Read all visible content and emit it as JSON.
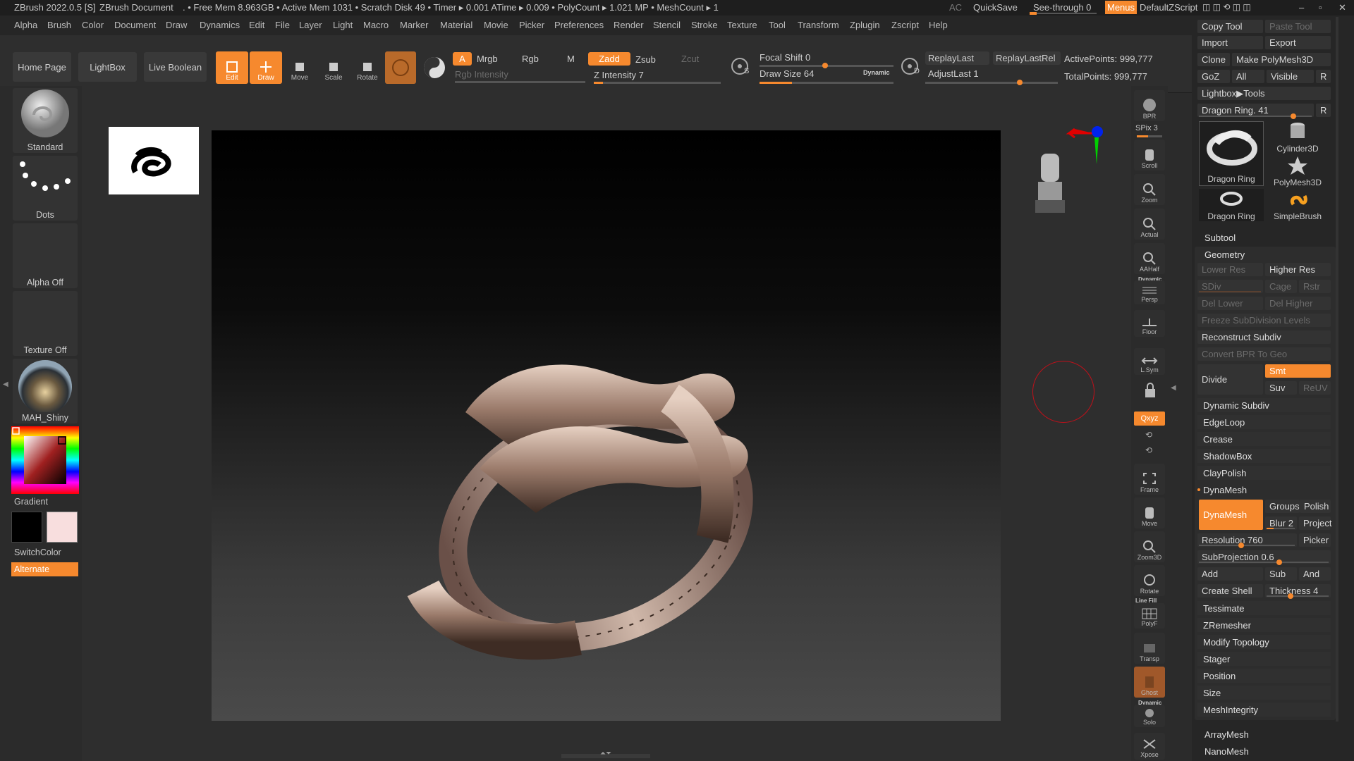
{
  "title_bar": {
    "app": "ZBrush 2022.0.5 [S]",
    "document": "ZBrush Document",
    "stats": ". • Free Mem 8.963GB • Active Mem 1031 • Scratch Disk 49 • Timer ▸ 0.001 ATime ▸ 0.009 • PolyCount ▸ 1.021 MP • MeshCount ▸ 1",
    "ac": "AC",
    "quicksave": "QuickSave",
    "see_through": "See-through 0",
    "menus": "Menus",
    "script": "DefaultZScript"
  },
  "menu_items": [
    "Alpha",
    "Brush",
    "Color",
    "Document",
    "Draw",
    "Dynamics",
    "Edit",
    "File",
    "Layer",
    "Light",
    "Macro",
    "Marker",
    "Material",
    "Movie",
    "Picker",
    "Preferences",
    "Render",
    "Stencil",
    "Stroke",
    "Texture",
    "Tool",
    "Transform",
    "Zplugin",
    "Zscript",
    "Help"
  ],
  "top_shelf": {
    "home": "Home Page",
    "lightbox": "LightBox",
    "live_boolean": "Live Boolean",
    "edit": "Edit",
    "draw": "Draw",
    "move": "Move",
    "scale": "Scale",
    "rotate": "Rotate",
    "a": "A",
    "mrgb": "Mrgb",
    "rgb": "Rgb",
    "m": "M",
    "rgb_intensity": "Rgb Intensity",
    "zadd": "Zadd",
    "zsub": "Zsub",
    "zcut": "Zcut",
    "z_intensity": "Z Intensity 7",
    "z_intensity_value": 7,
    "focal_shift": "Focal Shift 0",
    "draw_size": "Draw Size 64",
    "dynamic": "Dynamic",
    "replay_last": "ReplayLast",
    "replay_last_rel": "ReplayLastRel",
    "adjust_last": "AdjustLast 1",
    "active_points": "ActivePoints: 999,777",
    "total_points": "TotalPoints: 999,777",
    "s": "S",
    "d": "D"
  },
  "left_shelf": {
    "brush": "Standard",
    "stroke": "Dots",
    "alpha": "Alpha Off",
    "texture": "Texture Off",
    "material": "MAH_Shiny",
    "gradient": "Gradient",
    "switch_color": "SwitchColor",
    "alternate": "Alternate"
  },
  "right_shelf": [
    {
      "label": "BPR"
    },
    {
      "label": "SPix 3"
    },
    {
      "label": "Scroll"
    },
    {
      "label": "Zoom"
    },
    {
      "label": "Actual"
    },
    {
      "label": "AAHalf"
    },
    {
      "label": "Persp"
    },
    {
      "label": "Floor"
    },
    {
      "label": "L.Sym"
    },
    {
      "label": "Frame"
    },
    {
      "label": "Move"
    },
    {
      "label": "Zoom3D"
    },
    {
      "label": "Rotate"
    },
    {
      "label": "PolyF"
    },
    {
      "label": "Transp"
    },
    {
      "label": "Ghost"
    },
    {
      "label": "Solo"
    },
    {
      "label": "Xpose"
    }
  ],
  "right_shelf_extra": {
    "dynamic1": "Dynamic",
    "xyz": "Qxyz",
    "linefill": "Line Fill",
    "dynamic2": "Dynamic"
  },
  "tool_panel": {
    "copy_tool": "Copy Tool",
    "paste_tool": "Paste Tool",
    "import": "Import",
    "export": "Export",
    "clone": "Clone",
    "make_polymesh": "Make PolyMesh3D",
    "goz": "GoZ",
    "all": "All",
    "visible": "Visible",
    "r": "R",
    "lightbox_tools": "Lightbox▶Tools",
    "tool_slider": "Dragon Ring. 41",
    "thumbs": [
      "Dragon Ring",
      "Cylinder3D",
      "PolyMesh3D",
      "Dragon Ring",
      "SimpleBrush"
    ],
    "subtool": "Subtool",
    "geometry": "Geometry",
    "lower_res": "Lower Res",
    "higher_res": "Higher Res",
    "sdiv": "SDiv",
    "cage": "Cage",
    "rstr": "Rstr",
    "del_lower": "Del Lower",
    "del_higher": "Del Higher",
    "freeze": "Freeze SubDivision Levels",
    "reconstruct": "Reconstruct Subdiv",
    "convert_bpr": "Convert BPR To Geo",
    "divide": "Divide",
    "smt": "Smt",
    "suv": "Suv",
    "reuv": "ReUV",
    "dynamic_subdiv": "Dynamic Subdiv",
    "edgeloop": "EdgeLoop",
    "crease": "Crease",
    "shadowbox": "ShadowBox",
    "claypolish": "ClayPolish",
    "dynamesh_section": "DynaMesh",
    "dynamesh_btn": "DynaMesh",
    "groups": "Groups",
    "polish": "Polish",
    "blur": "Blur 2",
    "project": "Project",
    "resolution": "Resolution 760",
    "picker": "Picker",
    "subprojection": "SubProjection 0.6",
    "add": "Add",
    "sub": "Sub",
    "and": "And",
    "create_shell": "Create Shell",
    "thickness": "Thickness 4",
    "tessimate": "Tessimate",
    "zremesher": "ZRemesher",
    "modify_topology": "Modify Topology",
    "stager": "Stager",
    "position": "Position",
    "size": "Size",
    "meshintegrity": "MeshIntegrity",
    "arraymesh": "ArrayMesh",
    "nanomesh": "NanoMesh"
  },
  "colors": {
    "accent": "#f6892e",
    "bg": "#2b2b2b",
    "panel": "#262626"
  }
}
